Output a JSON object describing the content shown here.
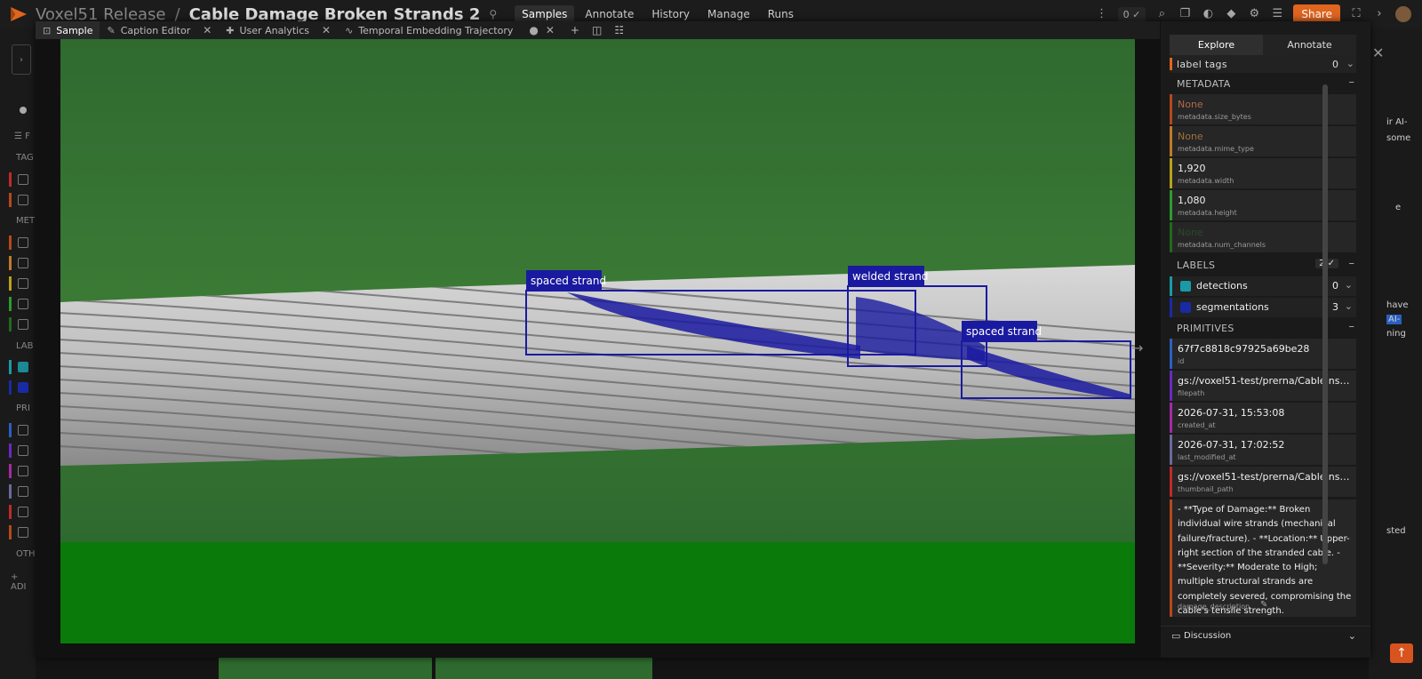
{
  "header": {
    "dataset": "Voxel51 Release",
    "separator": "/",
    "view": "Cable Damage Broken Strands 2",
    "pin_icon": "pin-icon",
    "nav": [
      "Samples",
      "Annotate",
      "History",
      "Manage",
      "Runs"
    ],
    "active_nav": "Samples",
    "selected_count": "0 ✓",
    "share_label": "Share"
  },
  "background_sidebar": {
    "filter_label": "F",
    "sections": [
      "TAG",
      "MET",
      "LAB",
      "PRI",
      "OTH"
    ],
    "add_label": "+ ADI"
  },
  "background_right": {
    "snippets": [
      "ir AI-",
      "some",
      "e",
      "have",
      "AI-",
      "ning",
      "sted"
    ]
  },
  "modal_tabs": [
    {
      "label": "Sample",
      "icon": "image-icon",
      "active": true
    },
    {
      "label": "Caption Editor",
      "icon": "edit-icon",
      "active": false
    },
    {
      "label": "User Analytics",
      "icon": "puzzle-icon",
      "active": false
    },
    {
      "label": "Temporal Embedding Trajectory",
      "icon": "chart-line-icon",
      "active": false
    }
  ],
  "viewer": {
    "detections": [
      {
        "label": "spaced strand"
      },
      {
        "label": "welded strand"
      },
      {
        "label": "spaced strand"
      }
    ],
    "box_color": "#1a1aa0"
  },
  "panel": {
    "tabs": [
      "Explore",
      "Annotate"
    ],
    "label_tags": {
      "title": "label tags",
      "count": "0"
    },
    "metadata_title": "METADATA",
    "metadata": [
      {
        "value": "None",
        "key": "metadata.size_bytes",
        "color": "#b5481c"
      },
      {
        "value": "None",
        "key": "metadata.mime_type",
        "color": "#c07a2a"
      },
      {
        "value": "1,920",
        "key": "metadata.width",
        "color": "#b8a21a"
      },
      {
        "value": "1,080",
        "key": "metadata.height",
        "color": "#2e9a2e"
      },
      {
        "value": "None",
        "key": "metadata.num_channels",
        "color": "#1f6b1f"
      }
    ],
    "labels_title": "LABELS",
    "labels_count": "2 ✓",
    "labels": [
      {
        "name": "detections",
        "count": "0",
        "color": "#1a9aa5",
        "checked": true
      },
      {
        "name": "segmentations",
        "count": "3",
        "color": "#1a2aa5",
        "checked": true
      }
    ],
    "primitives_title": "PRIMITIVES",
    "primitives": [
      {
        "value": "67f7c8818c97925a69be28",
        "key": "id",
        "color": "#2a5fc0"
      },
      {
        "value": "gs://voxel51-test/prerna/CableInspect-A...",
        "key": "filepath",
        "color": "#6a2ac0"
      },
      {
        "value": "2026-07-31, 15:53:08",
        "key": "created_at",
        "color": "#a52aa5"
      },
      {
        "value": "2026-07-31, 17:02:52",
        "key": "last_modified_at",
        "color": "#6a6a9a"
      },
      {
        "value": "gs://voxel51-test/prerna/CableInspect-A...",
        "key": "thumbnail_path",
        "color": "#c02a2a"
      }
    ],
    "description": {
      "text": "- **Type of Damage:** Broken individual wire strands (mechanical failure/fracture). - **Location:** Upper-right section of the stranded cable. - **Severity:** Moderate to High; multiple structural strands are completely severed, compromising the cable's tensile strength.",
      "key": "damage_description"
    },
    "discussion_label": "Discussion"
  }
}
